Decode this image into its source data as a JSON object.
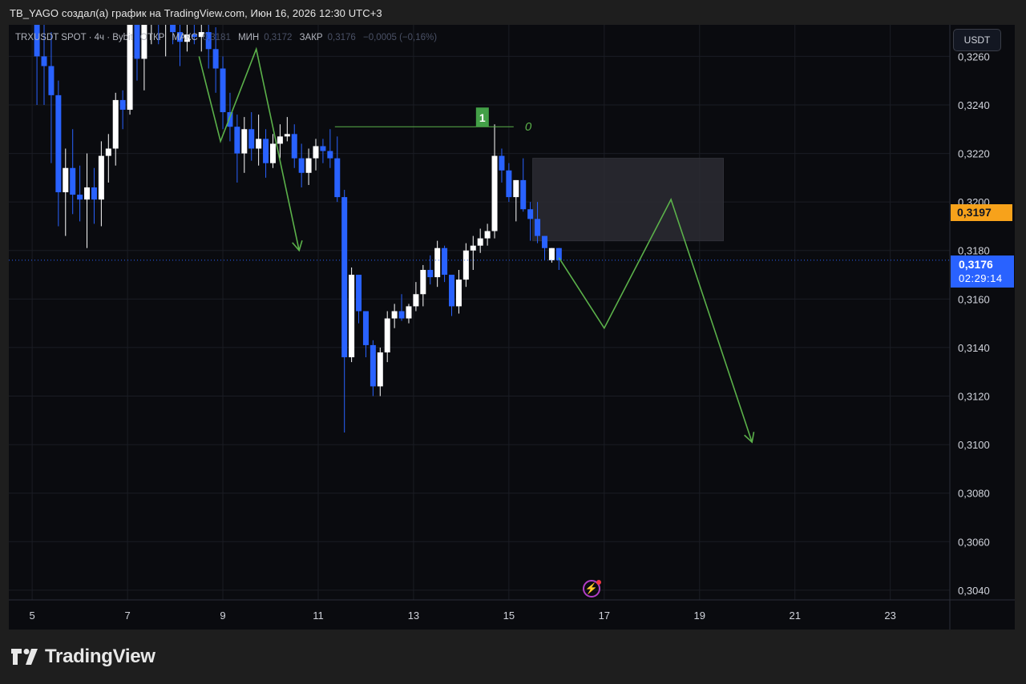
{
  "caption": "TB_YAGO создал(а) график на TradingView.com, Июн 16, 2026 12:30 UTC+3",
  "legend": {
    "symbol": "TRXUSDT SPOT · 4ч · Bybit",
    "open_label": "ОТКР",
    "high_label": "МАКС",
    "high_value": "0,3181",
    "low_label": "МИН",
    "low_value": "0,3172",
    "close_label": "ЗАКР",
    "close_value": "0,3176",
    "change": "−0,0005 (−0,16%)"
  },
  "currency": "USDT",
  "price_badge_orange": "0,3197",
  "last_price": "0,3176",
  "countdown": "02:29:14",
  "drawing_label": "1",
  "drawing_text": "0",
  "brand": "TradingView",
  "colors": {
    "bg": "#0a0b0f",
    "up": "#ffffff",
    "down": "#2962ff",
    "arrow": "#5bb14a",
    "label_green": "#43a047",
    "badge_orange": "#f7a21b",
    "badge_blue": "#2962ff"
  },
  "icons": [
    "flash-icon",
    "tradingview-logo-icon"
  ],
  "chart_data": {
    "type": "candlestick",
    "x_ticks": [
      "5",
      "7",
      "9",
      "11",
      "13",
      "15",
      "17",
      "19",
      "21",
      "23"
    ],
    "y_ticks": [
      "0,3260",
      "0,3240",
      "0,3220",
      "0,3200",
      "0,3180",
      "0,3160",
      "0,3140",
      "0,3120",
      "0,3100",
      "0,3080",
      "0,3060",
      "0,3040"
    ],
    "y_range": [
      0.3036,
      0.3273
    ],
    "x_range": [
      4.51,
      24.25
    ],
    "candles": [
      [
        5.1,
        0.328,
        0.332,
        0.324,
        0.326
      ],
      [
        5.25,
        0.326,
        0.328,
        0.324,
        0.3256
      ],
      [
        5.4,
        0.3256,
        0.327,
        0.3216,
        0.3244
      ],
      [
        5.55,
        0.3244,
        0.325,
        0.319,
        0.3204
      ],
      [
        5.7,
        0.3204,
        0.3222,
        0.3186,
        0.3214
      ],
      [
        5.85,
        0.3214,
        0.323,
        0.3195,
        0.3203
      ],
      [
        6.0,
        0.3203,
        0.3215,
        0.3192,
        0.3201
      ],
      [
        6.15,
        0.3201,
        0.322,
        0.3181,
        0.3206
      ],
      [
        6.3,
        0.3206,
        0.3214,
        0.3191,
        0.3201
      ],
      [
        6.45,
        0.3201,
        0.3225,
        0.319,
        0.3219
      ],
      [
        6.6,
        0.3219,
        0.3228,
        0.3208,
        0.3222
      ],
      [
        6.75,
        0.3222,
        0.3245,
        0.3215,
        0.3242
      ],
      [
        6.9,
        0.3242,
        0.3246,
        0.323,
        0.3238
      ],
      [
        7.05,
        0.3238,
        0.33,
        0.3236,
        0.329
      ],
      [
        7.2,
        0.329,
        0.331,
        0.325,
        0.3259
      ],
      [
        7.35,
        0.3259,
        0.3285,
        0.3246,
        0.3276
      ],
      [
        7.5,
        0.3276,
        0.33,
        0.3265,
        0.329
      ],
      [
        7.65,
        0.329,
        0.33,
        0.3265,
        0.328
      ],
      [
        7.8,
        0.328,
        0.33,
        0.326,
        0.329
      ],
      [
        7.95,
        0.329,
        0.33,
        0.3265,
        0.327
      ],
      [
        8.1,
        0.327,
        0.329,
        0.3256,
        0.3266
      ],
      [
        8.25,
        0.3266,
        0.3278,
        0.3262,
        0.3269
      ],
      [
        8.4,
        0.3269,
        0.328,
        0.3265,
        0.3268
      ],
      [
        8.55,
        0.3268,
        0.3278,
        0.3262,
        0.327
      ],
      [
        8.7,
        0.327,
        0.3279,
        0.3255,
        0.3263
      ],
      [
        8.85,
        0.3263,
        0.3272,
        0.3245,
        0.3255
      ],
      [
        9.0,
        0.3255,
        0.326,
        0.323,
        0.3237
      ],
      [
        9.15,
        0.3237,
        0.3245,
        0.3225,
        0.3231
      ],
      [
        9.3,
        0.3231,
        0.3236,
        0.3208,
        0.322
      ],
      [
        9.45,
        0.322,
        0.3235,
        0.3212,
        0.323
      ],
      [
        9.6,
        0.323,
        0.3237,
        0.3217,
        0.3222
      ],
      [
        9.75,
        0.3222,
        0.3236,
        0.3215,
        0.3226
      ],
      [
        9.9,
        0.3226,
        0.323,
        0.321,
        0.3216
      ],
      [
        10.05,
        0.3216,
        0.3228,
        0.3214,
        0.3224
      ],
      [
        10.2,
        0.3224,
        0.3232,
        0.3218,
        0.3227
      ],
      [
        10.35,
        0.3227,
        0.3235,
        0.3225,
        0.3228
      ],
      [
        10.5,
        0.3228,
        0.3232,
        0.3214,
        0.3218
      ],
      [
        10.65,
        0.3218,
        0.3224,
        0.3206,
        0.3212
      ],
      [
        10.8,
        0.3212,
        0.3222,
        0.3207,
        0.3218
      ],
      [
        10.95,
        0.3218,
        0.3226,
        0.3213,
        0.3223
      ],
      [
        11.1,
        0.3223,
        0.3226,
        0.3216,
        0.3221
      ],
      [
        11.25,
        0.3221,
        0.323,
        0.3214,
        0.3218
      ],
      [
        11.4,
        0.3218,
        0.3227,
        0.32,
        0.3202
      ],
      [
        11.55,
        0.3202,
        0.3205,
        0.3105,
        0.3136
      ],
      [
        11.7,
        0.3136,
        0.3173,
        0.3134,
        0.317
      ],
      [
        11.85,
        0.317,
        0.317,
        0.315,
        0.3155
      ],
      [
        12.0,
        0.3155,
        0.3155,
        0.3136,
        0.3141
      ],
      [
        12.15,
        0.3141,
        0.3143,
        0.312,
        0.3124
      ],
      [
        12.3,
        0.3124,
        0.314,
        0.312,
        0.3138
      ],
      [
        12.45,
        0.3138,
        0.3155,
        0.3134,
        0.3152
      ],
      [
        12.6,
        0.3152,
        0.3158,
        0.3148,
        0.3155
      ],
      [
        12.75,
        0.3155,
        0.3162,
        0.3151,
        0.3152
      ],
      [
        12.9,
        0.3152,
        0.3158,
        0.315,
        0.3157
      ],
      [
        13.05,
        0.3157,
        0.3167,
        0.3155,
        0.3162
      ],
      [
        13.2,
        0.3162,
        0.3174,
        0.3157,
        0.3172
      ],
      [
        13.35,
        0.3172,
        0.3178,
        0.3166,
        0.3169
      ],
      [
        13.5,
        0.3169,
        0.3184,
        0.3165,
        0.3181
      ],
      [
        13.65,
        0.3181,
        0.3182,
        0.3167,
        0.317
      ],
      [
        13.8,
        0.317,
        0.317,
        0.3153,
        0.3157
      ],
      [
        13.95,
        0.3157,
        0.3172,
        0.3154,
        0.3168
      ],
      [
        14.1,
        0.3168,
        0.3183,
        0.3165,
        0.318
      ],
      [
        14.25,
        0.318,
        0.3186,
        0.3172,
        0.3182
      ],
      [
        14.4,
        0.3182,
        0.3189,
        0.3179,
        0.3185
      ],
      [
        14.55,
        0.3185,
        0.3191,
        0.3182,
        0.3188
      ],
      [
        14.7,
        0.3188,
        0.3232,
        0.3185,
        0.3219
      ],
      [
        14.85,
        0.3219,
        0.3222,
        0.3208,
        0.3213
      ],
      [
        15.0,
        0.3213,
        0.3216,
        0.32,
        0.3202
      ],
      [
        15.15,
        0.3202,
        0.3209,
        0.3192,
        0.3209
      ],
      [
        15.3,
        0.3209,
        0.3218,
        0.3196,
        0.3197
      ],
      [
        15.45,
        0.3197,
        0.32,
        0.3184,
        0.3193
      ],
      [
        15.6,
        0.3193,
        0.32,
        0.3183,
        0.3186
      ],
      [
        15.75,
        0.3186,
        0.3186,
        0.3176,
        0.3181
      ],
      [
        15.9,
        0.3176,
        0.3181,
        0.3175,
        0.3181
      ],
      [
        16.05,
        0.3181,
        0.3181,
        0.3172,
        0.3176
      ]
    ],
    "rectangle": {
      "x_start": 15.5,
      "x_end": 19.5,
      "y_top": 0.3218,
      "y_bottom": 0.3184
    },
    "horizontal_line": {
      "x_start": 11.35,
      "x_end": 15.1,
      "y": 0.3231
    },
    "projection_path_1": [
      [
        8.5,
        0.326
      ],
      [
        8.95,
        0.3225
      ],
      [
        9.7,
        0.3263
      ],
      [
        10.6,
        0.318
      ]
    ],
    "projection_path_2": [
      [
        16.05,
        0.3177
      ],
      [
        17.0,
        0.3148
      ],
      [
        18.4,
        0.3201
      ],
      [
        20.1,
        0.3101
      ]
    ],
    "price_line": 0.3176
  }
}
